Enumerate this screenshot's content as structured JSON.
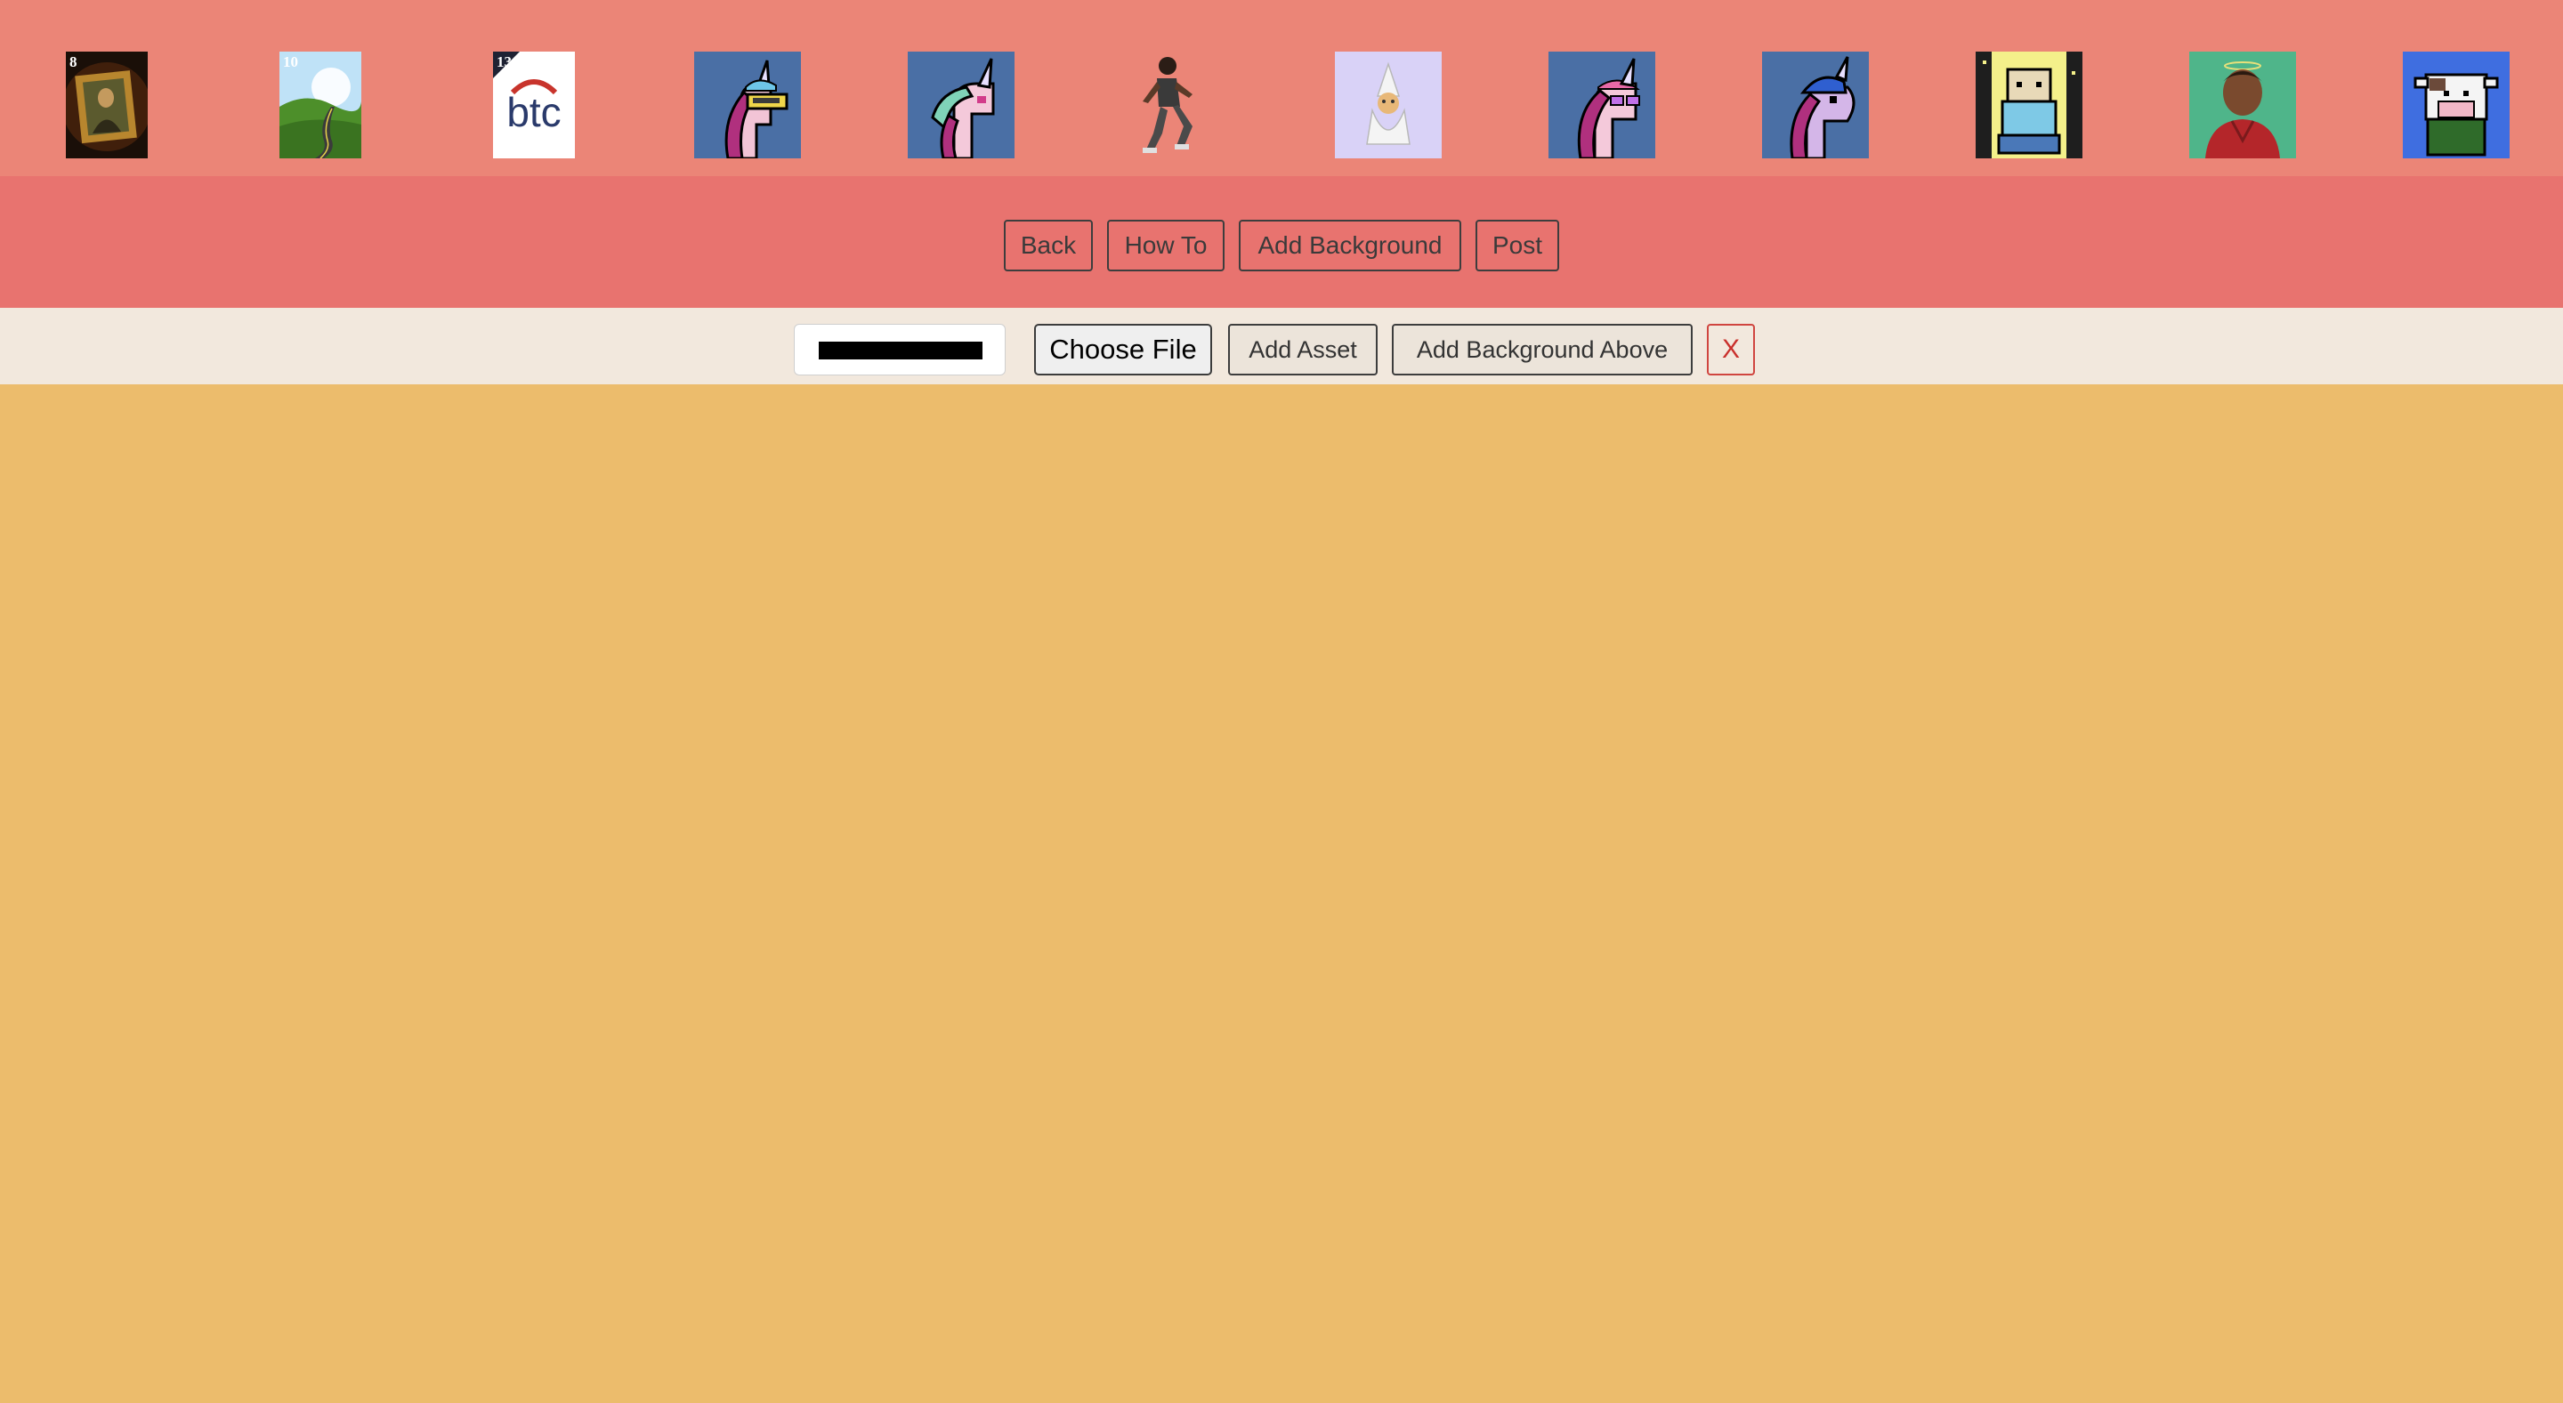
{
  "gallery": {
    "items": [
      {
        "name": "mona-lisa-frame-thumbnail",
        "badge": "8"
      },
      {
        "name": "landscape-road-thumbnail",
        "badge": "10"
      },
      {
        "name": "btc-logo-thumbnail",
        "badge": "13",
        "logo_text": "btc"
      },
      {
        "name": "unicorn-visor-thumbnail",
        "badge": ""
      },
      {
        "name": "unicorn-mint-mane-thumbnail",
        "badge": ""
      },
      {
        "name": "running-figure-thumbnail",
        "badge": ""
      },
      {
        "name": "white-wizard-thumbnail",
        "badge": ""
      },
      {
        "name": "unicorn-sunglasses-thumbnail",
        "badge": ""
      },
      {
        "name": "unicorn-blue-cap-thumbnail",
        "badge": ""
      },
      {
        "name": "sparkle-character-thumbnail",
        "badge": ""
      },
      {
        "name": "halo-portrait-thumbnail",
        "badge": ""
      },
      {
        "name": "pixel-cow-thumbnail",
        "badge": ""
      }
    ]
  },
  "toolbar": {
    "back_label": "Back",
    "howto_label": "How To",
    "add_background_label": "Add Background",
    "post_label": "Post"
  },
  "upload": {
    "color_value": "#000000",
    "choose_file_label": "Choose File",
    "add_asset_label": "Add Asset",
    "add_background_above_label": "Add Background Above",
    "close_label": "X"
  },
  "colors": {
    "gallery_bg": "#eb8577",
    "toolbar_bg": "#e8736f",
    "upload_bg": "#f2e8dd",
    "canvas_bg": "#ecbc6c",
    "close_accent": "#c9302c"
  }
}
